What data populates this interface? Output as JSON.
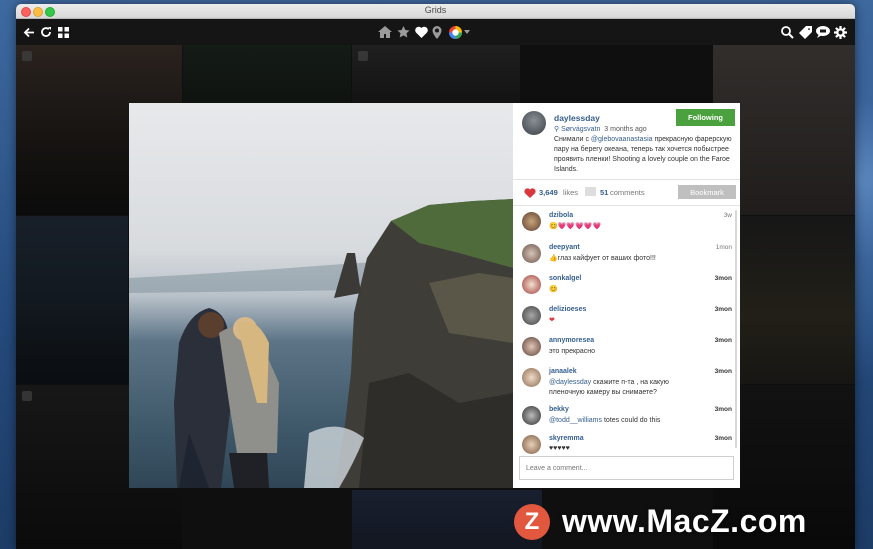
{
  "window": {
    "title": "Grids"
  },
  "toolbar": {
    "left_icons": [
      "back-arrow-icon",
      "refresh-icon",
      "grid-view-icon"
    ],
    "center_icons": [
      "home-icon",
      "star-icon",
      "heart-icon",
      "location-pin-icon",
      "account-avatar-icon",
      "dropdown-caret-icon"
    ],
    "right_icons": [
      "search-icon",
      "tag-icon",
      "message-bubble-icon",
      "gear-icon"
    ]
  },
  "post": {
    "username": "daylessday",
    "location": "Sørvágsvatn",
    "time_ago": "3 months ago",
    "follow_label": "Following",
    "caption_prefix": "Снимали с ",
    "caption_mention": "@glebovaanastasia",
    "caption_rest": " прекрасную фарерскую пару на берегу океана, теперь так хочется побыстрее проявить пленки! Shooting a lovely couple on the Faroe Islands.",
    "likes": "3,649",
    "likes_label": "likes",
    "comments_count": "51",
    "comments_label": "comments",
    "bookmark_label": "Bookmark"
  },
  "comments": [
    {
      "user": "dzibola",
      "text": "😊💗💗💗💗💗",
      "time": "3w"
    },
    {
      "user": "deepyant",
      "text": "👍глаз кайфует от ваших фото!!!",
      "time": "1mon"
    },
    {
      "user": "sonkalgel",
      "text": "😊",
      "time": "3mon"
    },
    {
      "user": "delizioeses",
      "text": "❤",
      "time": "3mon"
    },
    {
      "user": "annymoresea",
      "text": "это прекрасно",
      "time": "3mon"
    },
    {
      "user": "janaalek",
      "mention": "@daylessday",
      "text": " скажите п-та , на какую пленочную камеру вы снимаете?",
      "time": "3mon"
    },
    {
      "user": "bekky",
      "mention": "@todd__williams",
      "text": " totes could do this",
      "time": "3mon"
    },
    {
      "user": "skyremma",
      "text": "♥♥♥♥♥",
      "time": "3mon"
    }
  ],
  "comment_input": {
    "placeholder": "Leave a comment..."
  },
  "watermark": {
    "logo_letter": "Z",
    "text": "www.MacZ.com"
  },
  "colors": {
    "link": "#355e8e",
    "follow_green": "#4aa13d",
    "heart_red": "#d9363e",
    "watermark_logo": "#e2583e"
  }
}
